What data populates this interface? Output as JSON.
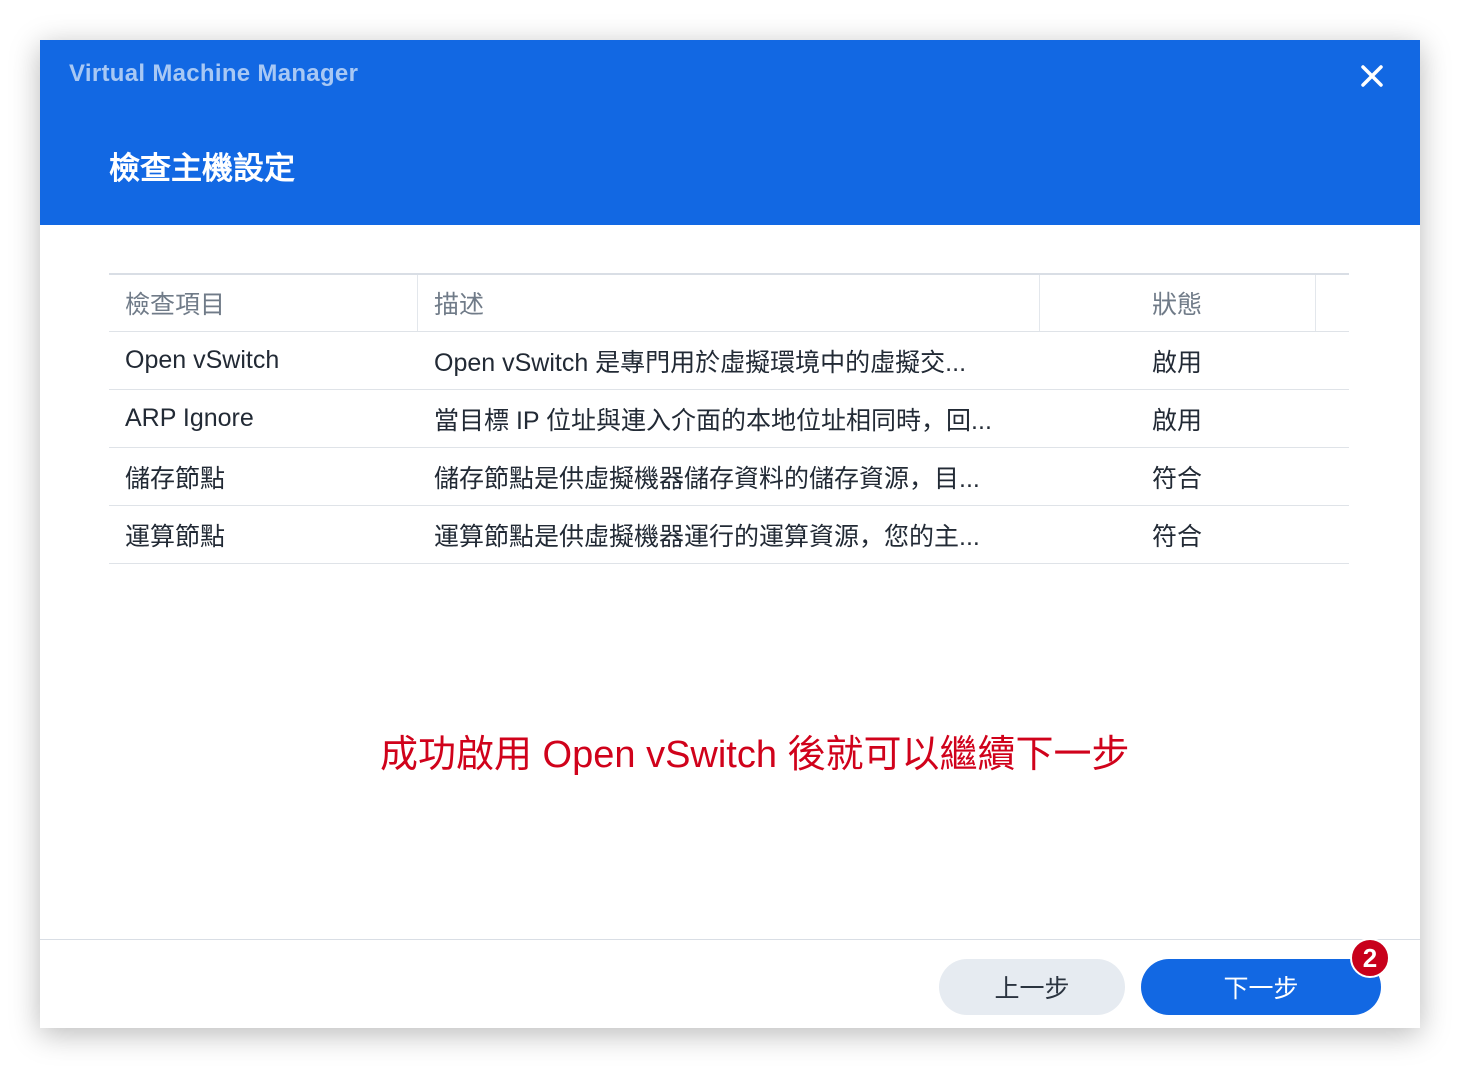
{
  "window": {
    "app_title": "Virtual Machine Manager",
    "step_title": "檢查主機設定",
    "close_icon": "close-icon",
    "header_color": "#1268e3"
  },
  "table": {
    "columns": [
      "檢查項目",
      "描述",
      "狀態"
    ],
    "rows": [
      {
        "item": "Open vSwitch",
        "description": "Open vSwitch 是專門用於虛擬環境中的虛擬交...",
        "status": "啟用"
      },
      {
        "item": "ARP Ignore",
        "description": "當目標 IP 位址與連入介面的本地位址相同時，回...",
        "status": "啟用"
      },
      {
        "item": "儲存節點",
        "description": "儲存節點是供虛擬機器儲存資料的儲存資源，目...",
        "status": "符合"
      },
      {
        "item": "運算節點",
        "description": "運算節點是供虛擬機器運行的運算資源，您的主...",
        "status": "符合"
      }
    ]
  },
  "annotation": {
    "text": "成功啟用 Open vSwitch 後就可以繼續下一步",
    "color": "#d0021b"
  },
  "footer": {
    "prev_label": "上一步",
    "next_label": "下一步",
    "badge": "2"
  }
}
